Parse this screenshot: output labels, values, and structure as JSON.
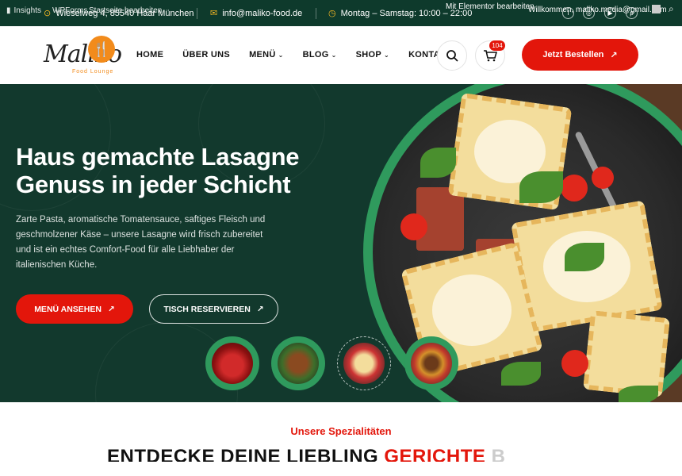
{
  "admin_bar": {
    "insights": "Insights",
    "wpforms": "WPForms",
    "startseite": "Startseite bearbeiten",
    "elementor": "Mit Elementor bearbeiten",
    "welcome": "Willkommen, maliko.media@gmail.com"
  },
  "topbar": {
    "address": "Wieselweg 4, 85540 Haar München",
    "email": "info@maliko-food.de",
    "hours": "Montag – Samstag: 10:00 – 22:00",
    "social": [
      "facebook-icon",
      "instagram-icon",
      "youtube-icon",
      "pinterest-icon"
    ]
  },
  "header": {
    "logo_script": "Maliko",
    "logo_sub": "Food Lounge",
    "nav": [
      {
        "label": "HOME",
        "dropdown": false
      },
      {
        "label": "ÜBER UNS",
        "dropdown": false
      },
      {
        "label": "MENÜ",
        "dropdown": true
      },
      {
        "label": "BLOG",
        "dropdown": true
      },
      {
        "label": "SHOP",
        "dropdown": true
      },
      {
        "label": "KONTAKT",
        "dropdown": false
      }
    ],
    "cart_count": "104",
    "order_button": "Jetzt Bestellen"
  },
  "hero": {
    "title_line1": "Haus gemachte Lasagne",
    "title_line2": "Genuss in jeder Schicht",
    "description": "Zarte Pasta, aromatische Tomatensauce, saftiges Fleisch und geschmolzener Käse – unsere Lasagne wird frisch zubereitet und ist ein echtes Comfort-Food für alle Liebhaber der italienischen Küche.",
    "btn_menu": "MENÜ ANSEHEN",
    "btn_table": "TISCH RESERVIEREN",
    "thumbnails": [
      "cake-thumbnail",
      "skewer-thumbnail",
      "ravioli-thumbnail",
      "burger-thumbnail"
    ],
    "active_thumbnail": 2
  },
  "specials": {
    "label": "Unsere Spezialitäten",
    "title_dark": "ENTDECKE DEINE LIEBLING",
    "title_red": "GERICHTE",
    "title_fade": "B"
  },
  "colors": {
    "brand_red": "#e3160b",
    "dark_green": "#12392d",
    "accent_green": "#2f9a5d",
    "gold": "#f2b624"
  }
}
